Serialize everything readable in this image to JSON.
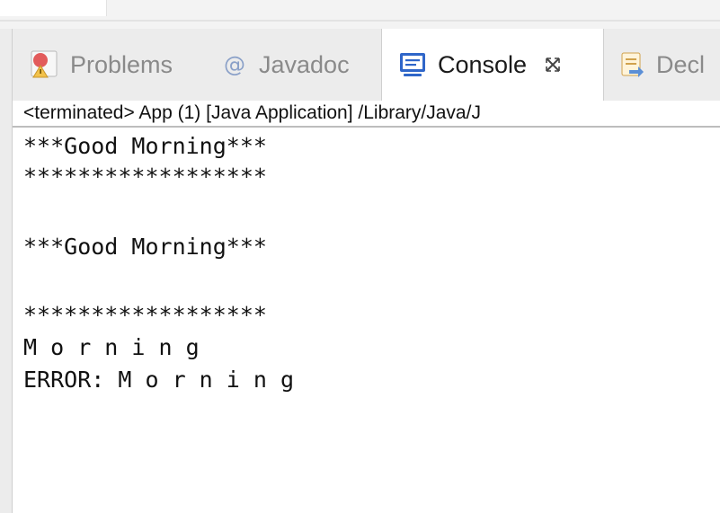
{
  "tabs": [
    {
      "label": "Problems",
      "icon": "problems-icon",
      "active": false
    },
    {
      "label": "Javadoc",
      "icon": "at-icon",
      "active": false
    },
    {
      "label": "Console",
      "icon": "console-icon",
      "active": true
    },
    {
      "label": "Decl",
      "icon": "declaration-icon",
      "active": false
    }
  ],
  "close_glyph": "⨯",
  "status": "<terminated> App (1) [Java Application] /Library/Java/J",
  "console_lines": [
    "***Good Morning***",
    "******************",
    "",
    "***Good Morning***",
    "",
    "******************",
    "M o r n i n g",
    "ERROR: M o r n i n g"
  ],
  "colors": {
    "panel_bg": "#ececec",
    "console_bg": "#ffffff",
    "text": "#111111",
    "inactive_tab_text": "#8a8a8a",
    "console_icon": "#2f66c9"
  }
}
